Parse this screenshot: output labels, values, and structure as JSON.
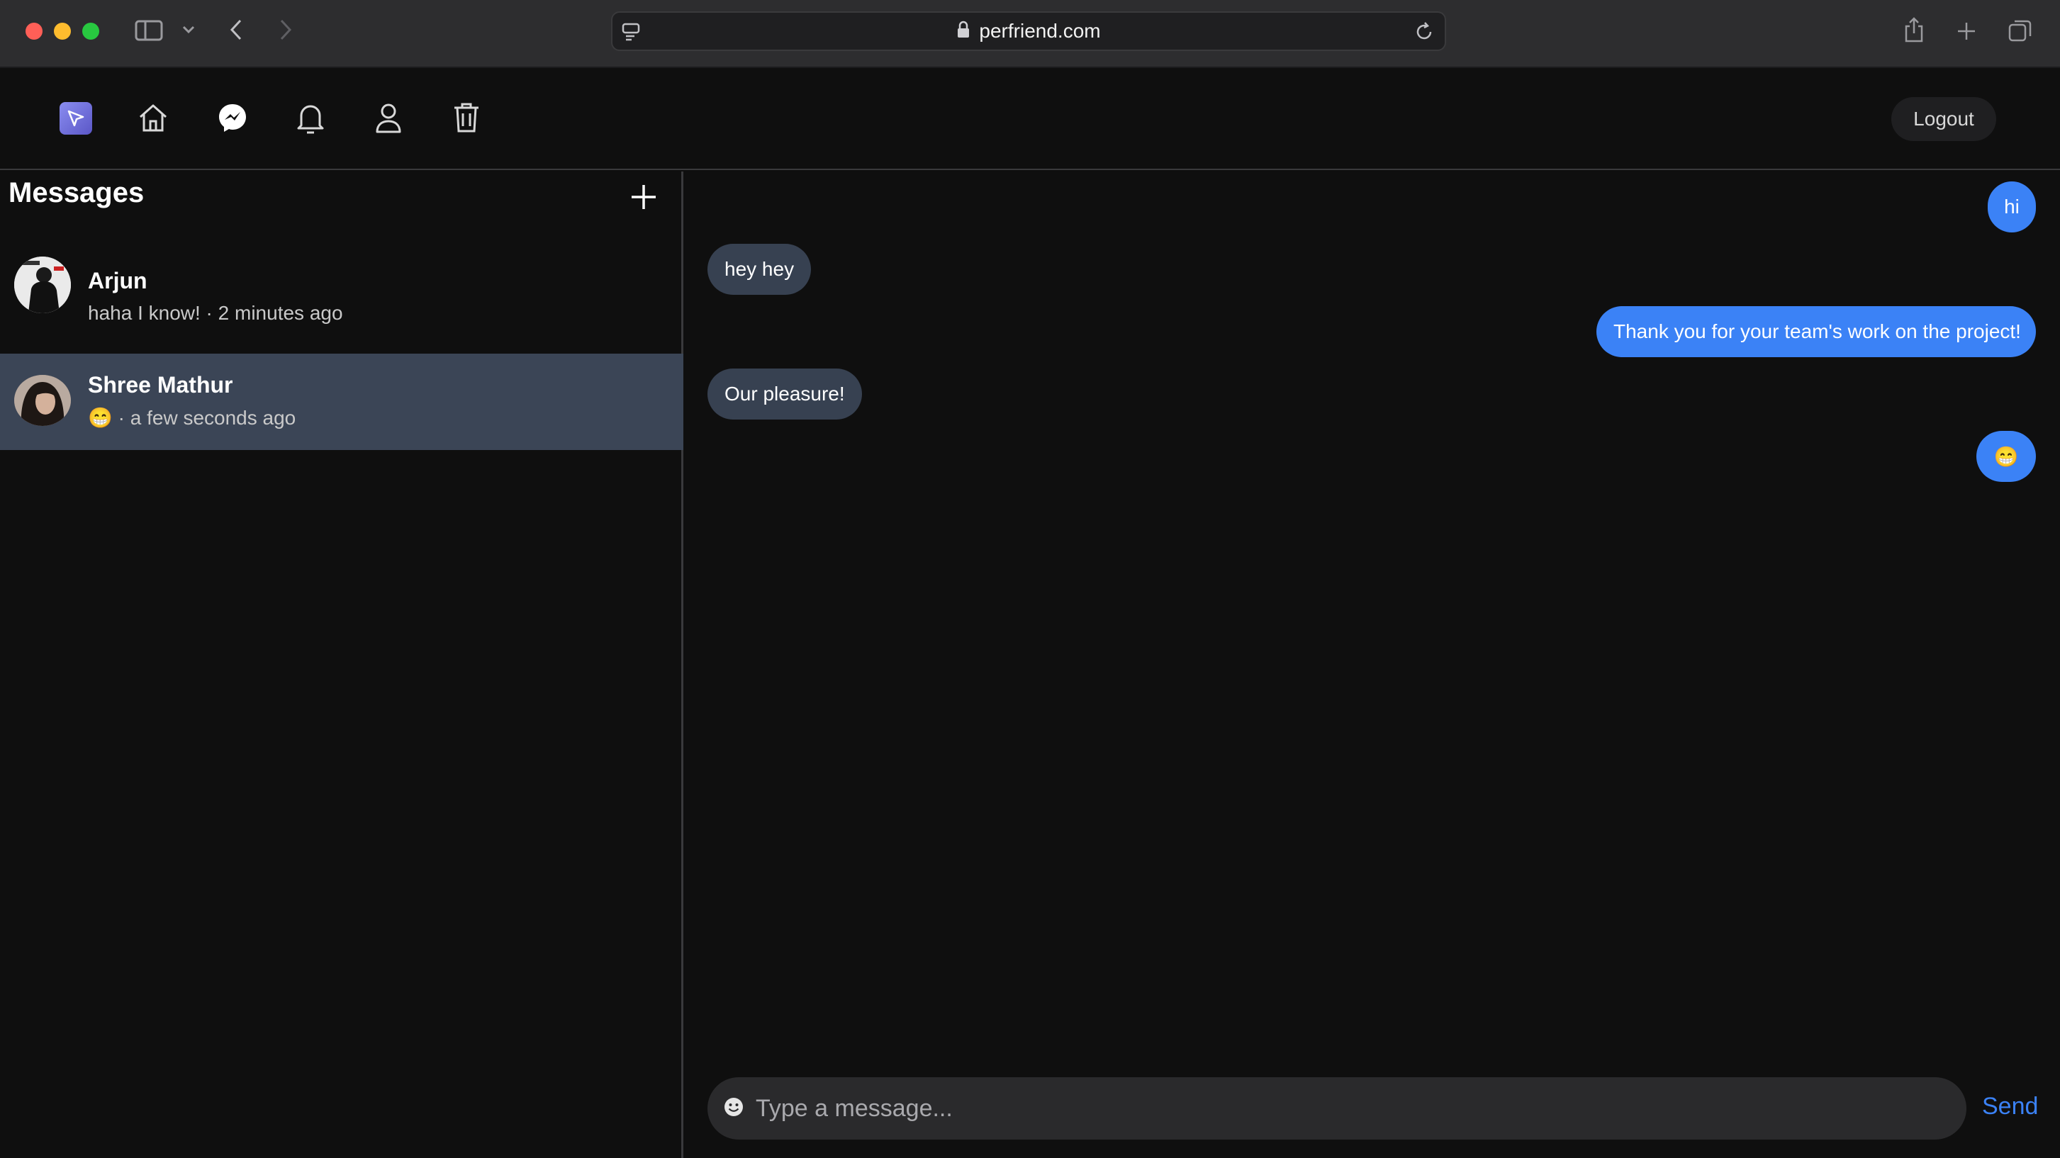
{
  "browser": {
    "url": "perfriend.com"
  },
  "nav": {
    "items": [
      {
        "icon": "home-icon"
      },
      {
        "icon": "messenger-icon"
      },
      {
        "icon": "bell-icon"
      },
      {
        "icon": "user-icon"
      },
      {
        "icon": "trash-icon"
      }
    ],
    "logout_label": "Logout"
  },
  "sidebar": {
    "title": "Messages",
    "conversations": [
      {
        "name": "Arjun",
        "preview": "haha I know! · 2 minutes ago"
      },
      {
        "name": "Shree Mathur",
        "emoji": "😁",
        "preview": " · a few seconds ago"
      }
    ]
  },
  "chat": {
    "messages": [
      {
        "direction": "out",
        "text": "hi"
      },
      {
        "direction": "in",
        "text": "hey hey"
      },
      {
        "direction": "out",
        "text": "Thank you for your team's work on the project!"
      },
      {
        "direction": "in",
        "text": "Our pleasure!"
      },
      {
        "direction": "out",
        "text": "😁"
      }
    ],
    "input_placeholder": "Type a message...",
    "send_label": "Send"
  },
  "colors": {
    "accent": "#3b82f6",
    "incoming_bubble": "#374151",
    "active_conversation": "#3b4556",
    "background": "#0f0f0f"
  }
}
